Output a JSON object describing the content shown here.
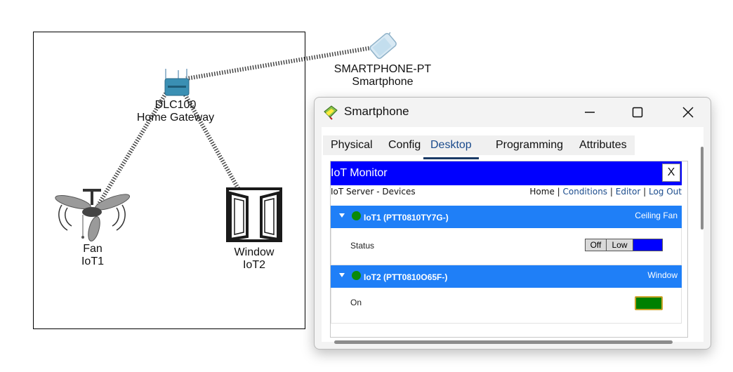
{
  "workspace": {
    "devices": [
      {
        "model": "DLC100",
        "name": "Home Gateway",
        "icon": "home-gateway-icon"
      },
      {
        "model": "Fan",
        "name": "IoT1",
        "icon": "ceiling-fan-icon"
      },
      {
        "model": "Window",
        "name": "IoT2",
        "icon": "window-icon"
      },
      {
        "model": "SMARTPHONE-PT",
        "name": "Smartphone",
        "icon": "smartphone-icon"
      }
    ]
  },
  "window": {
    "title": "Smartphone",
    "icon": "packet-tracer-app-icon",
    "controls": {
      "minimize": "minimize-icon",
      "maximize": "maximize-icon",
      "close": "close-icon"
    },
    "tabs": [
      "Physical",
      "Config",
      "Desktop",
      "Programming",
      "Attributes"
    ],
    "active_tab": "Desktop"
  },
  "iot_monitor": {
    "title": "IoT Monitor",
    "close_label": "X",
    "subtitle": "IoT Server - Devices",
    "nav": {
      "home": "Home",
      "sep1": "|",
      "conditions": "Conditions",
      "sep2": "|",
      "editor": "Editor",
      "sep3": "|",
      "logout": "Log Out"
    },
    "devices": [
      {
        "name": "IoT1 (PTT0810TY7G-)",
        "type": "Ceiling Fan",
        "status_label": "Status",
        "controls": [
          "Off",
          "Low"
        ],
        "status_color": "#0000ff"
      },
      {
        "name": "IoT2 (PTT0810O65F-)",
        "type": "Window",
        "status_label": "On",
        "status_color": "#008000"
      }
    ]
  },
  "colors": {
    "header_blue": "#0000ff",
    "card_blue": "#1f7ff7",
    "online_green": "#0a8a0a"
  }
}
